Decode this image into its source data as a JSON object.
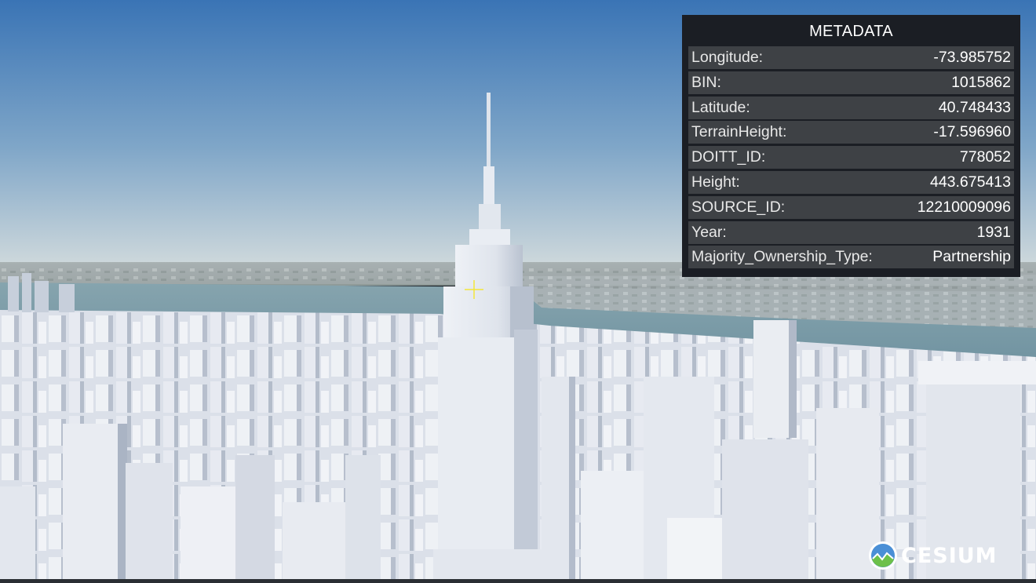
{
  "metadata_panel": {
    "title": "METADATA",
    "rows": [
      {
        "key": "Longitude:",
        "value": "-73.985752"
      },
      {
        "key": "BIN:",
        "value": "1015862"
      },
      {
        "key": "Latitude:",
        "value": "40.748433"
      },
      {
        "key": "TerrainHeight:",
        "value": "-17.596960"
      },
      {
        "key": "DOITT_ID:",
        "value": "778052"
      },
      {
        "key": "Height:",
        "value": "443.675413"
      },
      {
        "key": "SOURCE_ID:",
        "value": "12210009096"
      },
      {
        "key": "Year:",
        "value": "1931"
      },
      {
        "key": "Majority_Ownership_Type:",
        "value": "Partnership"
      }
    ]
  },
  "logo": {
    "text": "CESIUM",
    "icon": "cesium-globe-icon"
  },
  "crosshair": {
    "icon": "crosshair-icon",
    "color": "#f3e63a"
  },
  "colors": {
    "sky_top": "#3e78b8",
    "sky_horizon": "#c9d6dc",
    "river": "#7d9ba7",
    "building": "#e6e9ef",
    "building_shade": "#b9c2d1",
    "panel_bg": "#1b1e24",
    "row_bg": "#3e4145"
  }
}
